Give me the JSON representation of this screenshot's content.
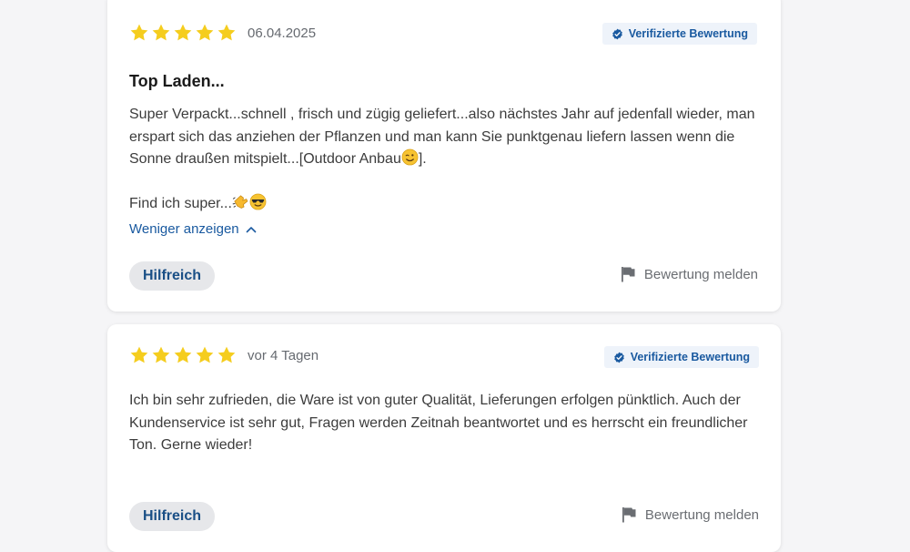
{
  "colors": {
    "star": "#f5cd1e",
    "badge_bg": "#eef3fa",
    "badge_text": "#1a5aa0",
    "link": "#1a5aa0",
    "helpful_bg": "#e6e7ea"
  },
  "reviews": [
    {
      "rating": 5,
      "date": "06.04.2025",
      "verified_label": "Verifizierte Bewertung",
      "title": "Top Laden...",
      "body_line1_a": "Super Verpackt...schnell , frisch und zügig geliefert...also nächstes Jahr auf jedenfall wieder, man erspart sich das anziehen der Pflanzen und man kann Sie punktgenau liefern lassen wenn die Sonne draußen mitspielt...[Outdoor Anbau",
      "body_line1_b": "].",
      "body_line2": "Find ich super...",
      "emojis": [
        "winking-face-emoji",
        "waving-hand-emoji",
        "sunglasses-face-emoji"
      ],
      "toggle_label": "Weniger anzeigen",
      "helpful_label": "Hilfreich",
      "report_label": "Bewertung melden"
    },
    {
      "rating": 5,
      "date": "vor 4 Tagen",
      "verified_label": "Verifizierte Bewertung",
      "body": "Ich bin sehr zufrieden, die Ware ist von guter Qualität, Lieferungen erfolgen pünktlich. Auch der Kundenservice ist sehr gut, Fragen werden Zeitnah beantwortet und es herrscht ein freundlicher Ton. Gerne wieder!",
      "helpful_label": "Hilfreich",
      "report_label": "Bewertung melden"
    }
  ]
}
